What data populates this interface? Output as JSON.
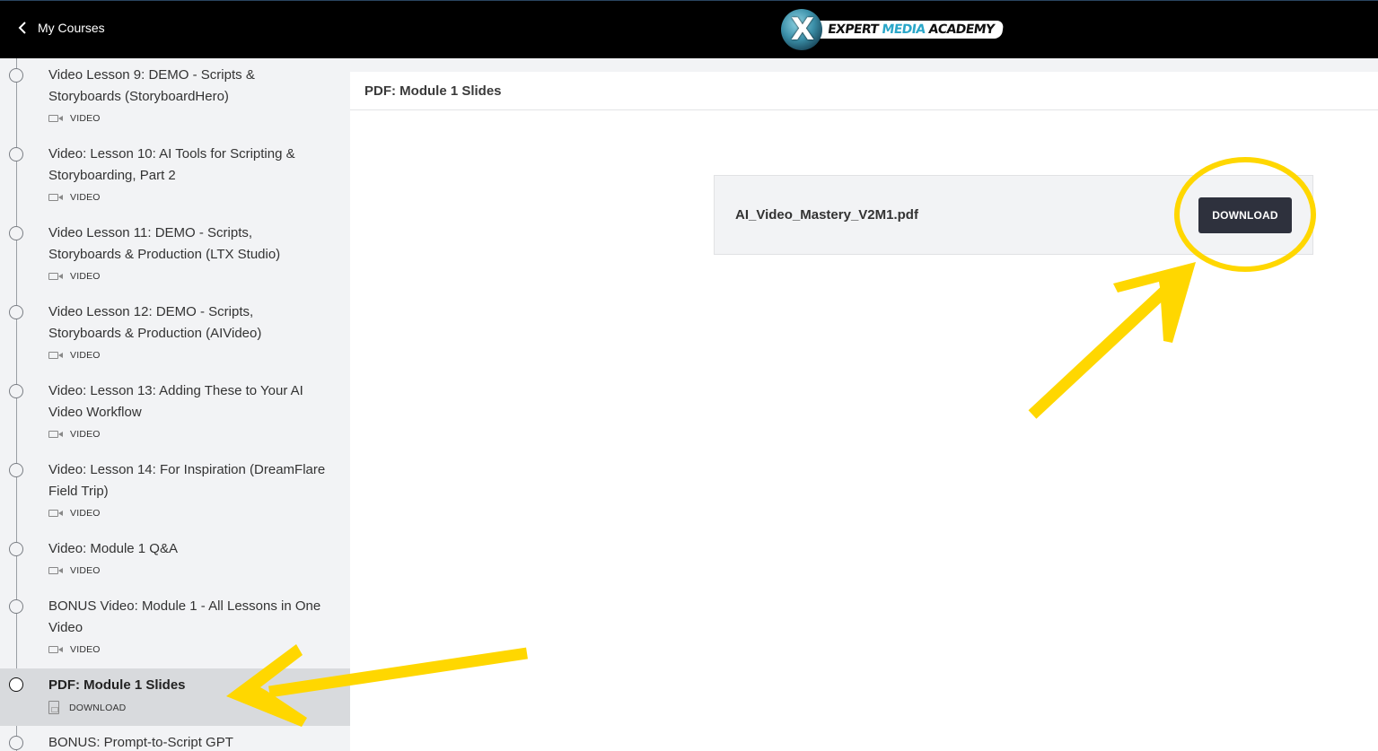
{
  "header": {
    "back_label": "My Courses",
    "logo_word1": "EXPERT",
    "logo_word2": "MEDIA",
    "logo_word3": "ACADEMY",
    "logo_mark": "X"
  },
  "sidebar": {
    "items": [
      {
        "title": "Video Lesson 9: DEMO - Scripts & Storyboards (StoryboardHero)",
        "type": "VIDEO",
        "icon": "video-icon"
      },
      {
        "title": "Video: Lesson 10: AI Tools for Scripting & Storyboarding, Part 2",
        "type": "VIDEO",
        "icon": "video-icon"
      },
      {
        "title": "Video Lesson 11: DEMO - Scripts, Storyboards & Production (LTX Studio)",
        "type": "VIDEO",
        "icon": "video-icon"
      },
      {
        "title": "Video Lesson 12: DEMO - Scripts, Storyboards & Production (AIVideo)",
        "type": "VIDEO",
        "icon": "video-icon"
      },
      {
        "title": "Video: Lesson 13: Adding These to Your AI Video Workflow",
        "type": "VIDEO",
        "icon": "video-icon"
      },
      {
        "title": "Video: Lesson 14: For Inspiration (DreamFlare Field Trip)",
        "type": "VIDEO",
        "icon": "video-icon"
      },
      {
        "title": "Video: Module 1 Q&A",
        "type": "VIDEO",
        "icon": "video-icon"
      },
      {
        "title": "BONUS Video: Module 1 - All Lessons in One Video",
        "type": "VIDEO",
        "icon": "video-icon"
      },
      {
        "title": "PDF: Module 1 Slides",
        "type": "DOWNLOAD",
        "icon": "pdf-icon",
        "active": true
      },
      {
        "title": "BONUS: Prompt-to-Script GPT",
        "type": "",
        "icon": ""
      }
    ]
  },
  "main": {
    "title": "PDF: Module 1 Slides",
    "file_name": "AI_Video_Mastery_V2M1.pdf",
    "download_label": "DOWNLOAD"
  },
  "annotation": {
    "highlight_color": "#FFD700"
  }
}
